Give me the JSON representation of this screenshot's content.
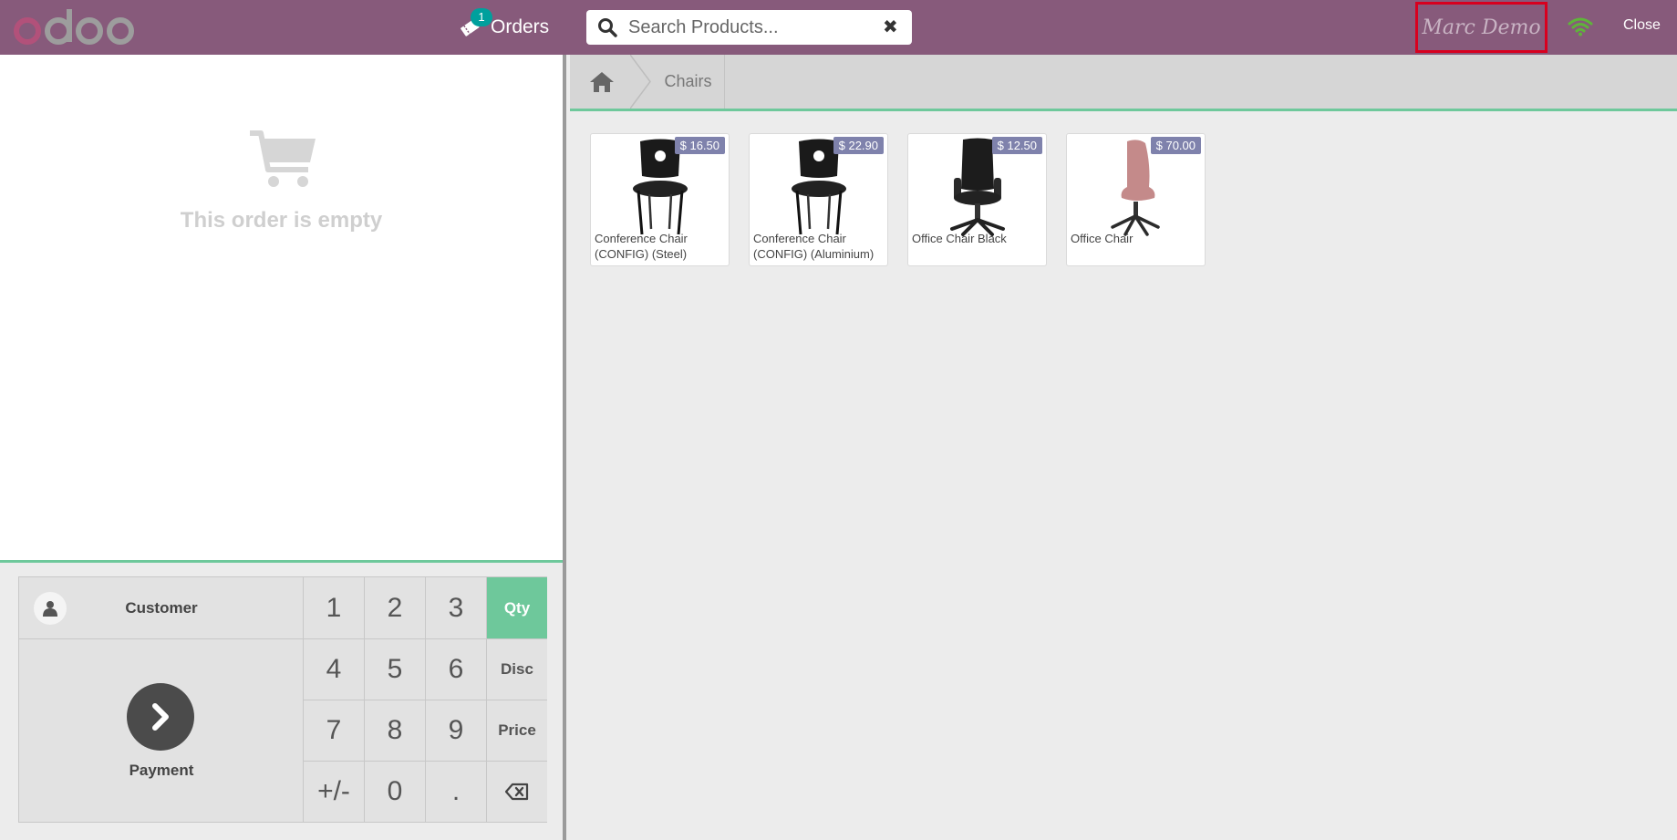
{
  "header": {
    "logo_text": "odoo",
    "orders_label": "Orders",
    "orders_count": "1",
    "search_placeholder": "Search Products...",
    "cashier_name": "Marc Demo",
    "close_label": "Close"
  },
  "order": {
    "empty_message": "This order is empty"
  },
  "actionpad": {
    "customer_label": "Customer",
    "payment_label": "Payment"
  },
  "numpad": {
    "keys": [
      "1",
      "2",
      "3",
      "Qty",
      "4",
      "5",
      "6",
      "Disc",
      "7",
      "8",
      "9",
      "Price",
      "+/-",
      "0",
      "."
    ],
    "active_mode": "Qty"
  },
  "breadcrumb": {
    "category": "Chairs"
  },
  "products": [
    {
      "name": "Conference Chair (CONFIG) (Steel)",
      "price": "$ 16.50"
    },
    {
      "name": "Conference Chair (CONFIG) (Aluminium)",
      "price": "$ 22.90"
    },
    {
      "name": "Office Chair Black",
      "price": "$ 12.50"
    },
    {
      "name": "Office Chair",
      "price": "$ 70.00"
    }
  ],
  "colors": {
    "header_bg": "#875a7b",
    "accent_green": "#6ec89b",
    "badge_teal": "#00a09d",
    "price_tag": "#7f82ac"
  }
}
